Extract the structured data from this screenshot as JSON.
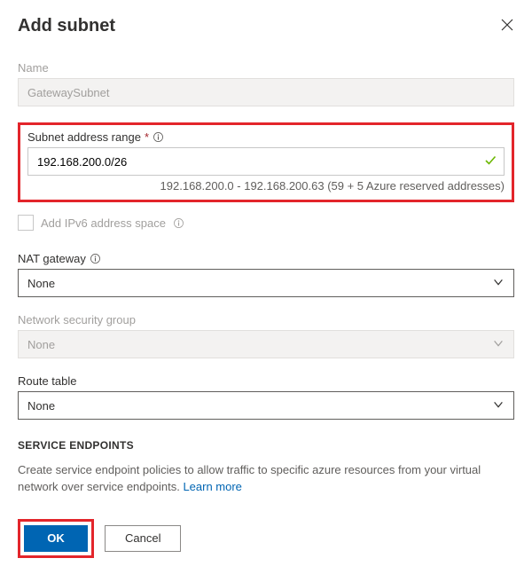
{
  "header": {
    "title": "Add subnet"
  },
  "name_field": {
    "label": "Name",
    "value": "GatewaySubnet"
  },
  "subnet_range": {
    "label": "Subnet address range",
    "value": "192.168.200.0/26",
    "helper": "192.168.200.0 - 192.168.200.63 (59 + 5 Azure reserved addresses)"
  },
  "ipv6": {
    "label": "Add IPv6 address space"
  },
  "nat_gateway": {
    "label": "NAT gateway",
    "selected": "None"
  },
  "nsg": {
    "label": "Network security group",
    "selected": "None"
  },
  "route_table": {
    "label": "Route table",
    "selected": "None"
  },
  "service_endpoints": {
    "heading": "SERVICE ENDPOINTS",
    "desc_prefix": "Create service endpoint policies to allow traffic to specific azure resources from your virtual network over service endpoints. ",
    "learn_more": "Learn more"
  },
  "footer": {
    "ok": "OK",
    "cancel": "Cancel"
  }
}
